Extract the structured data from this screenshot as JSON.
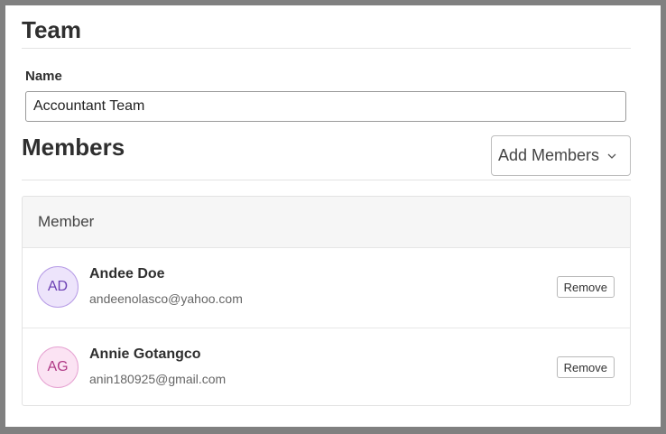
{
  "team": {
    "title": "Team",
    "name_label": "Name",
    "name_value": "Accountant Team"
  },
  "members_section": {
    "title": "Members",
    "add_button_label": "Add Members",
    "add_button_icon": "chevron-down-icon"
  },
  "table": {
    "header": "Member",
    "rows": [
      {
        "initials": "AD",
        "name": "Andee Doe",
        "email": "andeenolasco@yahoo.com",
        "avatar_color": "#ede4fb",
        "action_label": "Remove"
      },
      {
        "initials": "AG",
        "name": "Annie Gotangco",
        "email": "anin180925@gmail.com",
        "avatar_color": "#fbe3f3",
        "action_label": "Remove"
      }
    ]
  }
}
